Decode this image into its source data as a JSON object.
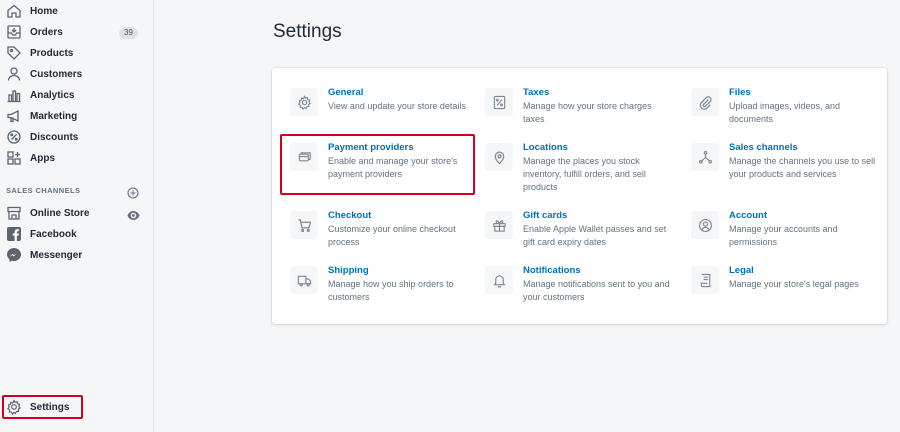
{
  "sidebar": {
    "items": [
      {
        "label": "Home"
      },
      {
        "label": "Orders",
        "badge": "39"
      },
      {
        "label": "Products"
      },
      {
        "label": "Customers"
      },
      {
        "label": "Analytics"
      },
      {
        "label": "Marketing"
      },
      {
        "label": "Discounts"
      },
      {
        "label": "Apps"
      }
    ],
    "sales_channels_title": "SALES CHANNELS",
    "channels": [
      {
        "label": "Online Store"
      },
      {
        "label": "Facebook"
      },
      {
        "label": "Messenger"
      }
    ],
    "settings_label": "Settings"
  },
  "page": {
    "title": "Settings"
  },
  "settings": {
    "items": [
      {
        "title": "General",
        "desc": "View and update your store details",
        "icon": "gear-icon"
      },
      {
        "title": "Taxes",
        "desc": "Manage how your store charges taxes",
        "icon": "percent-icon"
      },
      {
        "title": "Files",
        "desc": "Upload images, videos, and documents",
        "icon": "paperclip-icon"
      },
      {
        "title": "Payment providers",
        "desc": "Enable and manage your store's payment providers",
        "icon": "credit-card-icon"
      },
      {
        "title": "Locations",
        "desc": "Manage the places you stock inventory, fulfill orders, and sell products",
        "icon": "location-pin-icon"
      },
      {
        "title": "Sales channels",
        "desc": "Manage the channels you use to sell your products and services",
        "icon": "channels-icon"
      },
      {
        "title": "Checkout",
        "desc": "Customize your online checkout process",
        "icon": "cart-icon"
      },
      {
        "title": "Gift cards",
        "desc": "Enable Apple Wallet passes and set gift card expiry dates",
        "icon": "gift-icon"
      },
      {
        "title": "Account",
        "desc": "Manage your accounts and permissions",
        "icon": "profile-icon"
      },
      {
        "title": "Shipping",
        "desc": "Manage how you ship orders to customers",
        "icon": "truck-icon"
      },
      {
        "title": "Notifications",
        "desc": "Manage notifications sent to you and your customers",
        "icon": "bell-icon"
      },
      {
        "title": "Legal",
        "desc": "Manage your store's legal pages",
        "icon": "document-icon"
      }
    ]
  },
  "colors": {
    "link": "#006fbb",
    "highlight": "#d0021b",
    "sidebar_bg": "#f4f6f8",
    "card_bg": "#ffffff"
  }
}
